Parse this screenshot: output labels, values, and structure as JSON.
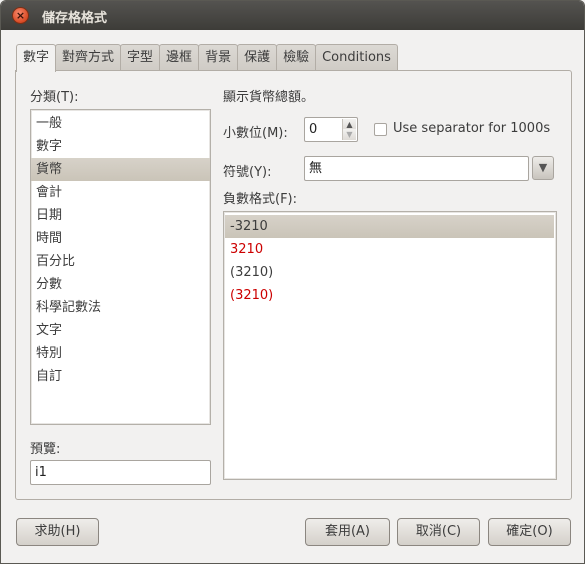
{
  "window": {
    "title": "儲存格格式"
  },
  "tabs": [
    {
      "label": "數字",
      "active": true
    },
    {
      "label": "對齊方式",
      "active": false
    },
    {
      "label": "字型",
      "active": false
    },
    {
      "label": "邊框",
      "active": false
    },
    {
      "label": "背景",
      "active": false
    },
    {
      "label": "保護",
      "active": false
    },
    {
      "label": "檢驗",
      "active": false
    },
    {
      "label": "Conditions",
      "active": false
    }
  ],
  "category": {
    "label": "分類(T):",
    "items": [
      "一般",
      "數字",
      "貨幣",
      "會計",
      "日期",
      "時間",
      "百分比",
      "分數",
      "科學記數法",
      "文字",
      "特別",
      "自訂"
    ],
    "selected": "貨幣"
  },
  "preview": {
    "label": "預覽:",
    "value": "i1"
  },
  "description": "顯示貨幣總額。",
  "decimal": {
    "label": "小數位(M):",
    "value": "0"
  },
  "separator": {
    "label": "Use separator for 1000s",
    "checked": false
  },
  "symbol": {
    "label": "符號(Y):",
    "value": "無"
  },
  "negative": {
    "label": "負數格式(F):",
    "items": [
      "-3210",
      "3210",
      "(3210)",
      "(3210)"
    ],
    "selected": "-3210"
  },
  "buttons": {
    "help": "求助(H)",
    "apply": "套用(A)",
    "cancel": "取消(C)",
    "ok": "確定(O)"
  },
  "colors": {
    "negative_red": "#cc0000",
    "selection": "#cec8bd"
  }
}
